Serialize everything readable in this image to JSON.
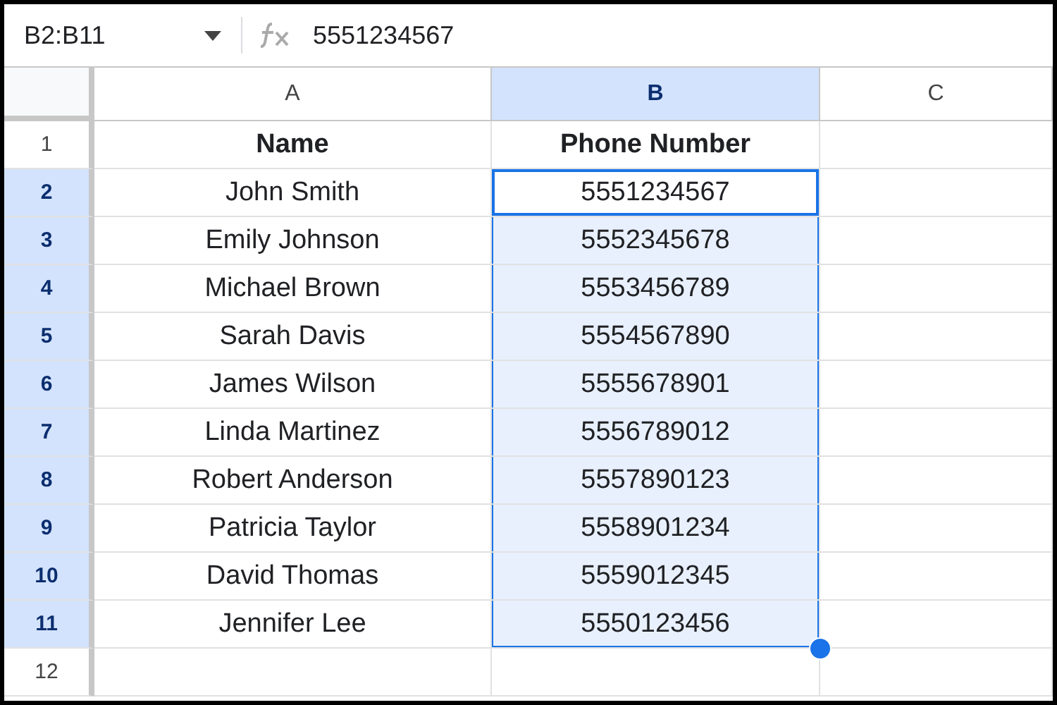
{
  "name_box": "B2:B11",
  "formula_bar": {
    "value": "5551234567"
  },
  "columns": [
    {
      "label": "A",
      "selected": false
    },
    {
      "label": "B",
      "selected": true
    },
    {
      "label": "C",
      "selected": false
    }
  ],
  "rows": [
    {
      "number": "1",
      "selected": false,
      "kind": "header",
      "cells": [
        {
          "text": "Name",
          "active": false
        },
        {
          "text": "Phone Number",
          "active": false
        }
      ]
    },
    {
      "number": "2",
      "selected": true,
      "kind": "data",
      "cells": [
        {
          "text": "John Smith",
          "active": false
        },
        {
          "text": "5551234567",
          "active": true
        }
      ]
    },
    {
      "number": "3",
      "selected": true,
      "kind": "data",
      "cells": [
        {
          "text": "Emily Johnson",
          "active": false
        },
        {
          "text": "5552345678",
          "active": false
        }
      ]
    },
    {
      "number": "4",
      "selected": true,
      "kind": "data",
      "cells": [
        {
          "text": "Michael Brown",
          "active": false
        },
        {
          "text": "5553456789",
          "active": false
        }
      ]
    },
    {
      "number": "5",
      "selected": true,
      "kind": "data",
      "cells": [
        {
          "text": "Sarah Davis",
          "active": false
        },
        {
          "text": "5554567890",
          "active": false
        }
      ]
    },
    {
      "number": "6",
      "selected": true,
      "kind": "data",
      "cells": [
        {
          "text": "James Wilson",
          "active": false
        },
        {
          "text": "5555678901",
          "active": false
        }
      ]
    },
    {
      "number": "7",
      "selected": true,
      "kind": "data",
      "cells": [
        {
          "text": "Linda Martinez",
          "active": false
        },
        {
          "text": "5556789012",
          "active": false
        }
      ]
    },
    {
      "number": "8",
      "selected": true,
      "kind": "data",
      "cells": [
        {
          "text": "Robert Anderson",
          "active": false
        },
        {
          "text": "5557890123",
          "active": false
        }
      ]
    },
    {
      "number": "9",
      "selected": true,
      "kind": "data",
      "cells": [
        {
          "text": "Patricia Taylor",
          "active": false
        },
        {
          "text": "5558901234",
          "active": false
        }
      ]
    },
    {
      "number": "10",
      "selected": true,
      "kind": "data",
      "cells": [
        {
          "text": "David Thomas",
          "active": false
        },
        {
          "text": "5559012345",
          "active": false
        }
      ]
    },
    {
      "number": "11",
      "selected": true,
      "kind": "data",
      "cells": [
        {
          "text": "Jennifer Lee",
          "active": false
        },
        {
          "text": "5550123456",
          "active": false
        }
      ]
    },
    {
      "number": "12",
      "selected": false,
      "kind": "data",
      "cells": []
    }
  ]
}
